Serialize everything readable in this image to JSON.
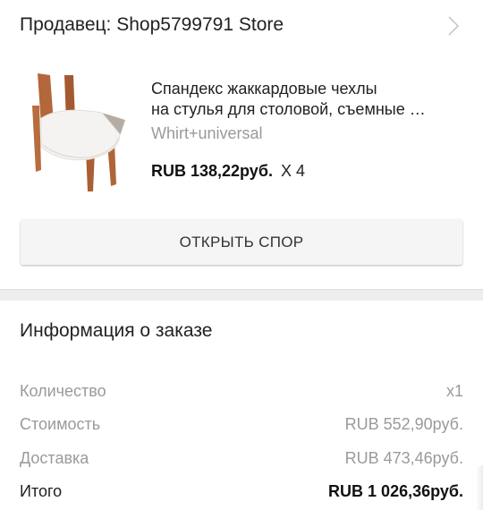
{
  "seller": {
    "title": "Продавец: Shop5799791 Store",
    "chevron_icon": "chevron-right-icon"
  },
  "product": {
    "image_icon": "chair-cover-thumbnail",
    "title_line1": "Спандекс жаккардовые чехлы",
    "title_line2": "на стулья для столовой, съемные …",
    "variant": "Whirt+universal",
    "price": "RUB 138,22руб.",
    "quantity": "X 4"
  },
  "actions": {
    "open_dispute_label": "ОТКРЫТЬ СПОР"
  },
  "order_info": {
    "title": "Информация о заказе",
    "rows": [
      {
        "label": "Количество",
        "value": "x1"
      },
      {
        "label": "Стоимость",
        "value": "RUB 552,90руб."
      },
      {
        "label": "Доставка",
        "value": "RUB 473,46руб."
      },
      {
        "label": "Итого",
        "value": "RUB 1 026,36руб."
      }
    ]
  },
  "colors": {
    "muted_text": "#9a9a9a",
    "button_bg": "#f5f5f5",
    "divider_band": "#eeeeee"
  }
}
